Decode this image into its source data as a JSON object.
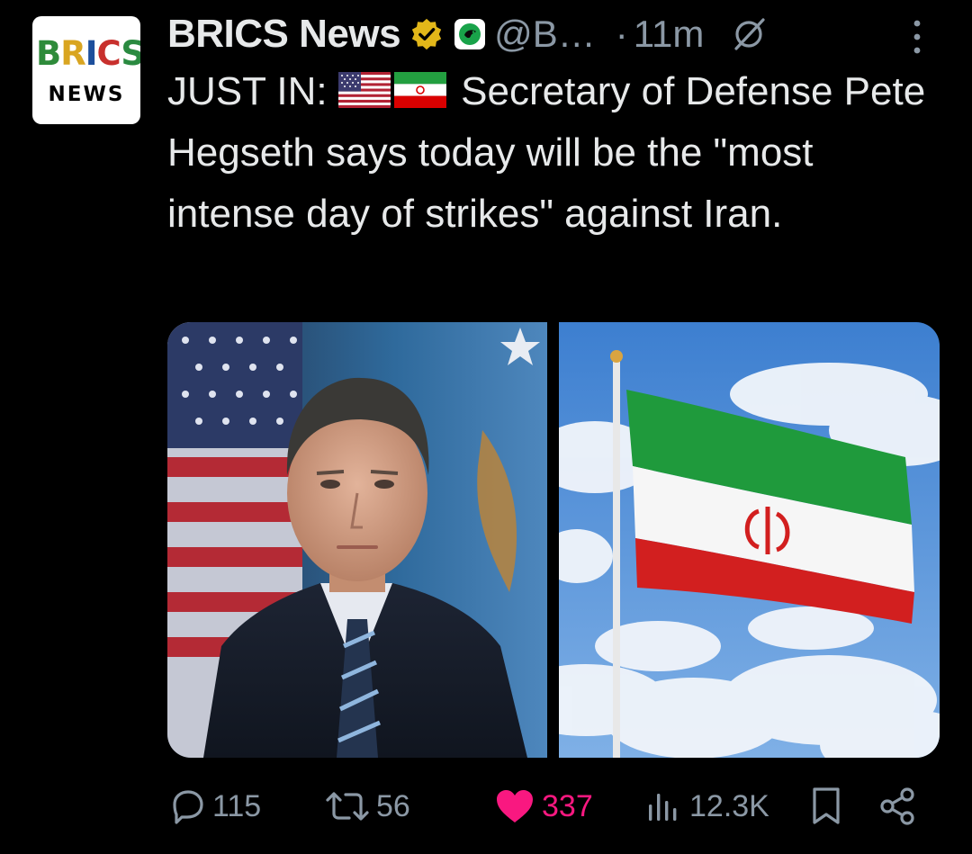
{
  "author": {
    "display_name": "BRICS News",
    "handle": "@B…",
    "separator": "·",
    "timestamp": "11m",
    "avatar": {
      "logo_word": "BRICS",
      "logo_subword": "NEWS"
    },
    "verified_icon": "gold-verified-checkmark-icon",
    "affiliate_icon": "affiliate-badge-icon"
  },
  "tweet": {
    "lead": "JUST IN:",
    "flags": [
      "us-flag-emoji",
      "iran-flag-emoji"
    ],
    "body": "Secretary of Defense Pete Hegseth says today will be the \"most intense day of strikes\" against Iran."
  },
  "media": [
    {
      "kind": "portrait photo",
      "icon": "photo-left"
    },
    {
      "kind": "flag photo",
      "icon": "photo-right"
    }
  ],
  "actions": {
    "replies": "115",
    "reposts": "56",
    "likes": "337",
    "views": "12.3K",
    "icons": [
      "reply-icon",
      "repost-icon",
      "like-icon",
      "views-icon",
      "bookmark-icon",
      "share-icon"
    ]
  },
  "colors": {
    "background": "#000000",
    "text_primary": "#e7e9ea",
    "text_secondary": "#8b98a5",
    "like_active": "#f91880",
    "verified_gold": "#e2b719"
  }
}
